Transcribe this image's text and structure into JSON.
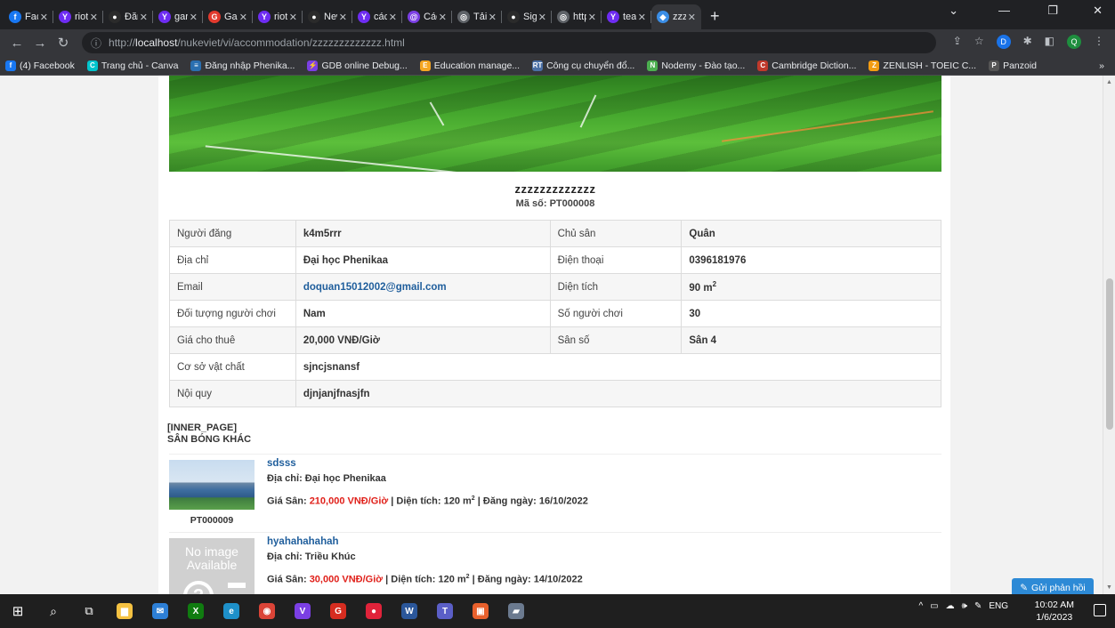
{
  "browser": {
    "tabs": [
      {
        "label": "Facel",
        "color": "#1877f2",
        "glyph": "f"
      },
      {
        "label": "riot c",
        "color": "#6e2cf2",
        "glyph": "Y"
      },
      {
        "label": "Đăng",
        "color": "#2b2b2b",
        "glyph": "●"
      },
      {
        "label": "garei",
        "color": "#6e2cf2",
        "glyph": "Y"
      },
      {
        "label": "Gare",
        "color": "#e23a2e",
        "glyph": "G"
      },
      {
        "label": "riot c",
        "color": "#6e2cf2",
        "glyph": "Y"
      },
      {
        "label": "New",
        "color": "#2b2b2b",
        "glyph": "●"
      },
      {
        "label": "cách",
        "color": "#6e2cf2",
        "glyph": "Y"
      },
      {
        "label": "Cách",
        "color": "#7b3fe4",
        "glyph": "@"
      },
      {
        "label": "Tải L",
        "color": "#5f6368",
        "glyph": "◎"
      },
      {
        "label": "Sign",
        "color": "#2b2b2b",
        "glyph": "●"
      },
      {
        "label": "http:",
        "color": "#5f6368",
        "glyph": "◎"
      },
      {
        "label": "team",
        "color": "#6e2cf2",
        "glyph": "Y"
      },
      {
        "label": "zzzz",
        "color": "#3b8ee6",
        "glyph": "◆",
        "active": true
      }
    ],
    "url_prefix": "http://",
    "url_host": "localhost",
    "url_path": "/nukeviet/vi/accommodation/zzzzzzzzzzzzz.html",
    "profile_initial": "D",
    "profile2_initial": "Q",
    "bookmarks": [
      {
        "label": "(4) Facebook",
        "color": "#1877f2",
        "glyph": "f"
      },
      {
        "label": "Trang chủ - Canva",
        "color": "#00c4cc",
        "glyph": "C"
      },
      {
        "label": "Đăng nhập Phenika...",
        "color": "#2a6fb0",
        "glyph": "≡"
      },
      {
        "label": "GDB online Debug...",
        "color": "#7b3fe4",
        "glyph": "⚡"
      },
      {
        "label": "Education manage...",
        "color": "#f5a623",
        "glyph": "E"
      },
      {
        "label": "Công cụ chuyển đổ...",
        "color": "#4a6fa5",
        "glyph": "RT"
      },
      {
        "label": "Nodemy - Đào tạo...",
        "color": "#4caf50",
        "glyph": "N"
      },
      {
        "label": "Cambridge Diction...",
        "color": "#c0392b",
        "glyph": "C"
      },
      {
        "label": "ZENLISH - TOEIC C...",
        "color": "#f39c12",
        "glyph": "Z"
      },
      {
        "label": "Panzoid",
        "color": "#555555",
        "glyph": "P"
      }
    ]
  },
  "accommodation": {
    "title": "zzzzzzzzzzzzz",
    "code": "Mã số: PT000008",
    "details": [
      {
        "label1": "Người đăng",
        "value1": "k4m5rrr",
        "label2": "Chủ sân",
        "value2": "Quân"
      },
      {
        "label1": "Địa chỉ",
        "value1": "Đại học Phenikaa",
        "label2": "Điện thoại",
        "value2": "0396181976"
      },
      {
        "label1": "Email",
        "value1": "doquan15012002@gmail.com",
        "label2": "Diện tích",
        "value2": "90 m",
        "value2_sup": "2"
      },
      {
        "label1": "Đối tượng người chơi",
        "value1": "Nam",
        "label2": "Số người chơi",
        "value2": "30"
      },
      {
        "label1": "Giá cho thuê",
        "value1": "20,000 VNĐ/Giờ",
        "label2": "Sân số",
        "value2": "Sân 4"
      },
      {
        "label1": "Cơ sở vật chất",
        "value1": "sjncjsnansf"
      },
      {
        "label1": "Nội quy",
        "value1": "djnjanjfnasjfn"
      }
    ],
    "inner_page": "[INNER_PAGE]",
    "other_heading": "SÂN BÓNG KHÁC",
    "others": [
      {
        "name": "sdsss",
        "address": "Địa chỉ: Đại học Phenikaa",
        "price_label": "Giá Sân:",
        "price": "210,000 VNĐ/Giờ",
        "area": "| Diện tích: 120 m",
        "area_sup": "2",
        "date": "| Đăng ngày: 16/10/2022",
        "code": "PT000009"
      },
      {
        "name": "hyahahahahah",
        "address": "Địa chỉ: Triều Khúc",
        "price_label": "Giá Sân:",
        "price": "30,000 VNĐ/Giờ",
        "area": "| Diện tích: 120 m",
        "area_sup": "2",
        "date": "| Đăng ngày: 14/10/2022",
        "noimage_line1": "No image",
        "noimage_line2": "Available"
      }
    ],
    "feedback_label": "Gửi phản hồi"
  },
  "taskbar": {
    "apps": [
      {
        "name": "explorer",
        "color": "#f5c242",
        "glyph": "▆"
      },
      {
        "name": "mail",
        "color": "#2d7fd6",
        "glyph": "✉"
      },
      {
        "name": "xbox",
        "color": "#107c10",
        "glyph": "X"
      },
      {
        "name": "edge",
        "color": "#1e90c9",
        "glyph": "e"
      },
      {
        "name": "chrome",
        "color": "#db4437",
        "glyph": "◉"
      },
      {
        "name": "visual-studio",
        "color": "#7b3fe4",
        "glyph": "V"
      },
      {
        "name": "garena",
        "color": "#d62d20",
        "glyph": "G"
      },
      {
        "name": "app-red",
        "color": "#e0233a",
        "glyph": "●"
      },
      {
        "name": "word",
        "color": "#2b579a",
        "glyph": "W"
      },
      {
        "name": "teams",
        "color": "#5b5fc7",
        "glyph": "T"
      },
      {
        "name": "app-orange",
        "color": "#e8602c",
        "glyph": "▣"
      },
      {
        "name": "app-gray",
        "color": "#6b7a8f",
        "glyph": "▰"
      }
    ],
    "lang": "ENG",
    "time": "10:02 AM",
    "date": "1/6/2023"
  }
}
